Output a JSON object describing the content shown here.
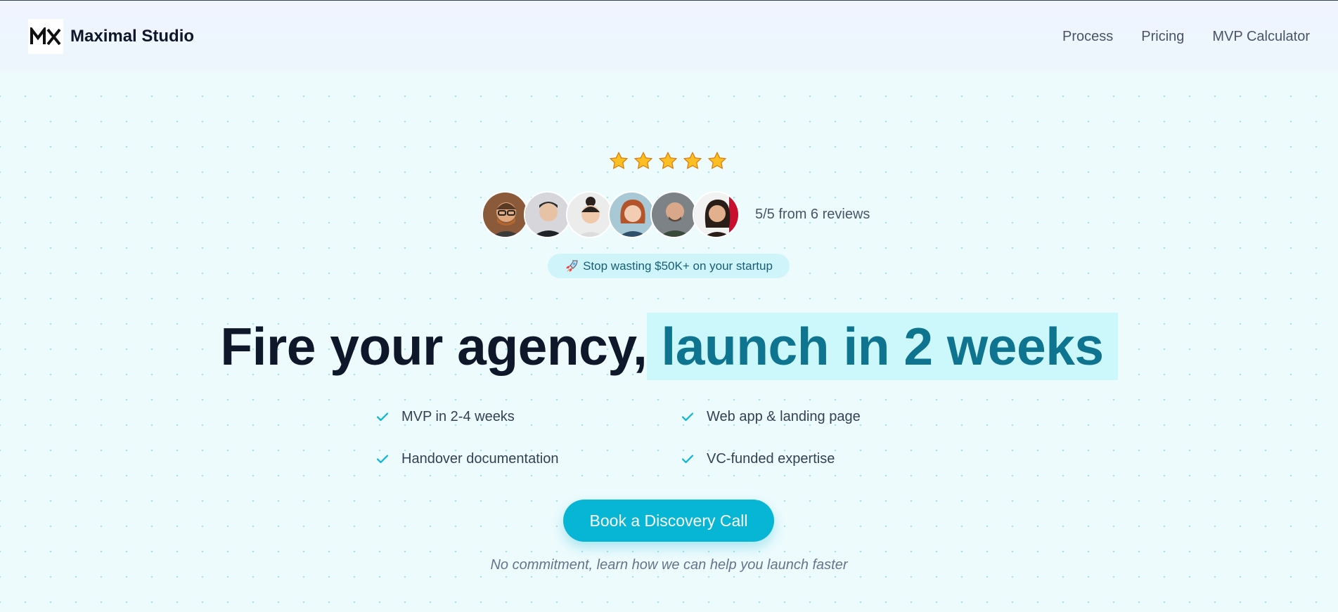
{
  "brand": {
    "logo_text": "MX",
    "name": "Maximal Studio"
  },
  "nav": {
    "items": [
      {
        "label": "Process"
      },
      {
        "label": "Pricing"
      },
      {
        "label": "MVP Calculator"
      }
    ]
  },
  "social_proof": {
    "stars": 5,
    "star_color": "#fbbf24",
    "avatars": [
      {
        "name": "reviewer-1"
      },
      {
        "name": "reviewer-2"
      },
      {
        "name": "reviewer-3"
      },
      {
        "name": "reviewer-4"
      },
      {
        "name": "reviewer-5"
      },
      {
        "name": "reviewer-6"
      }
    ],
    "rating_text": "5/5 from 6 reviews"
  },
  "badge": {
    "icon": "rocket-icon",
    "text": "Stop wasting $50K+ on your startup"
  },
  "hero": {
    "title_plain": "Fire your agency,",
    "title_highlight": "launch in 2 weeks"
  },
  "features": [
    {
      "label": "MVP in 2-4 weeks"
    },
    {
      "label": "Web app & landing page"
    },
    {
      "label": "Handover documentation"
    },
    {
      "label": "VC-funded expertise"
    }
  ],
  "cta": {
    "label": "Book a Discovery Call",
    "note": "No commitment, learn how we can help you launch faster"
  },
  "colors": {
    "accent": "#06b6d4",
    "highlight_bg": "#cdf8fb",
    "highlight_text": "#0e7490",
    "heading": "#0f172a"
  }
}
